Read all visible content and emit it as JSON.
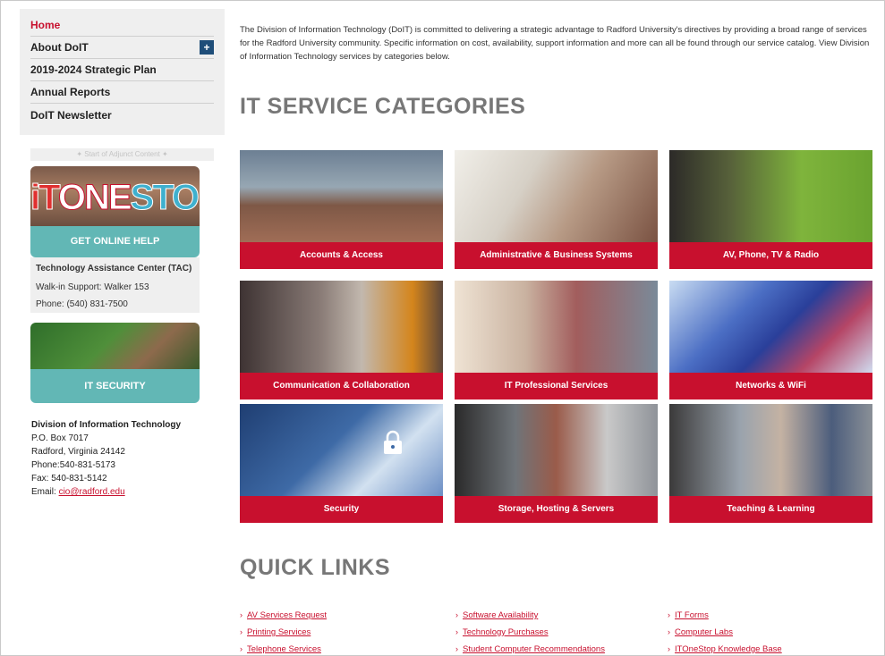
{
  "sidebar": {
    "nav": [
      {
        "label": "Home",
        "active": true,
        "expand": false
      },
      {
        "label": "About DoIT",
        "active": false,
        "expand": true
      },
      {
        "label": "2019-2024 Strategic Plan",
        "active": false,
        "expand": false
      },
      {
        "label": "Annual Reports",
        "active": false,
        "expand": false
      },
      {
        "label": "DoIT Newsletter",
        "active": false,
        "expand": false
      }
    ],
    "expand_symbol": "+",
    "adjunct_label": "✦ Start of Adjunct Content ✦",
    "onestop": {
      "it": "iT",
      "one": "ONE",
      "stop": "STOP",
      "button": "GET ONLINE HELP"
    },
    "tac": {
      "title": "Technology Assistance Center (TAC)",
      "walkin": "Walk-in Support:  Walker 153",
      "phone": "Phone: (540) 831-7500"
    },
    "security_button": "IT SECURITY",
    "contact": {
      "title": "Division of Information Technology",
      "po": "P.O. Box 7017",
      "city": "Radford, Virginia 24142",
      "phone": "Phone:540-831-5173",
      "fax": "Fax: 540-831-5142",
      "email_label": "Email: ",
      "email": "cio@radford.edu"
    }
  },
  "main": {
    "intro": "The Division of Information Technology (DoIT) is committed to delivering a strategic advantage to Radford University's directives by providing a broad range of services for the Radford University community.  Specific information on cost, availability, support information and more can all be found through our service catalog. View Division of Information Technology services by categories below.",
    "categories_heading": "IT SERVICE CATEGORIES",
    "tiles": [
      {
        "label": "Accounts & Access"
      },
      {
        "label": "Administrative & Business Systems"
      },
      {
        "label": "AV, Phone, TV & Radio"
      },
      {
        "label": "Communication & Collaboration"
      },
      {
        "label": "IT Professional Services"
      },
      {
        "label": "Networks & WiFi"
      },
      {
        "label": "Security"
      },
      {
        "label": "Storage, Hosting & Servers"
      },
      {
        "label": "Teaching & Learning"
      }
    ],
    "quick_links_heading": "QUICK LINKS",
    "quick_links": [
      [
        "AV Services Request",
        "Printing Services",
        "Telephone Services"
      ],
      [
        "Software Availability",
        "Technology Purchases",
        "Student Computer Recommendations"
      ],
      [
        "IT Forms",
        "Computer Labs",
        "ITOneStop Knowledge Base"
      ]
    ],
    "link_arrow": "›"
  }
}
